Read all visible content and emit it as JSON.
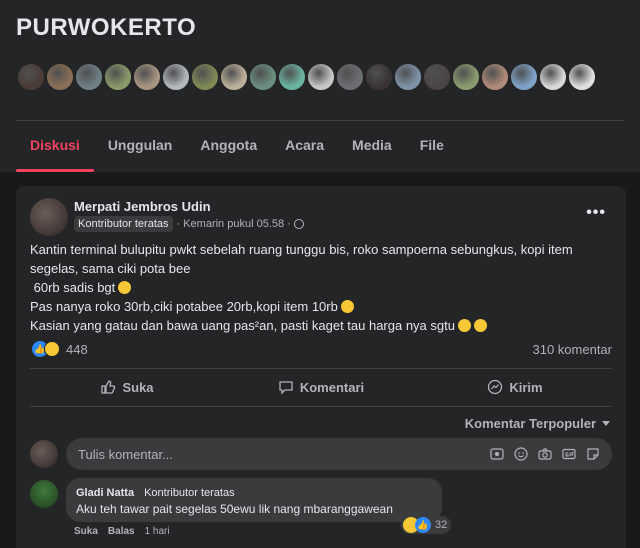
{
  "group": {
    "name": "PURWOKERTO",
    "member_avatars": [
      "#4a3b35",
      "#8a6e55",
      "#6f7f86",
      "#8a9a6a",
      "#a89682",
      "#b2b8bd",
      "#7d8a55",
      "#bdb09a",
      "#6a8f7e",
      "#6bb5a0",
      "#c6c6c6",
      "#6c6f72",
      "#3a3334",
      "#7f93a8",
      "#4b4445",
      "#8a9b6e",
      "#b08a78",
      "#7fa3c8",
      "#d7d8da",
      "#e0e0e0"
    ]
  },
  "tabs": [
    {
      "label": "Diskusi",
      "active": true
    },
    {
      "label": "Unggulan",
      "active": false
    },
    {
      "label": "Anggota",
      "active": false
    },
    {
      "label": "Acara",
      "active": false
    },
    {
      "label": "Media",
      "active": false
    },
    {
      "label": "File",
      "active": false
    }
  ],
  "post": {
    "author": "Merpati Jembros Udin",
    "badge": "Kontributor teratas",
    "time": "· Kemarin pukul 05.58 ·",
    "privacy_icon": "globe-icon",
    "more_label": "•••",
    "lines": [
      "Kantin terminal bulupitu pwkt sebelah ruang tunggu bis, roko sampoerna sebungkus, kopi item",
      "segelas, sama ciki pota bee",
      " 60rb sadis bgt",
      "Pas nanya roko 30rb,ciki potabee 20rb,kopi item 10rb",
      "Kasian yang gatau dan bawa uang pas²an, pasti kaget tau harga nya sgtu"
    ],
    "reaction_count": "448",
    "comment_count": "310 komentar",
    "actions": {
      "like": "Suka",
      "comment": "Komentari",
      "share": "Kirim"
    },
    "sort_label": "Komentar Terpopuler",
    "comment_placeholder": "Tulis komentar..."
  },
  "top_comment": {
    "author": "Gladi Natta",
    "badge": "Kontributor teratas",
    "text": "Aku teh tawar pait segelas 50ewu lik nang mbaranggawean",
    "reaction_count": "32",
    "like_label": "Suka",
    "reply_label": "Balas",
    "time": "1 hari"
  },
  "colors": {
    "accent": "#f3425f",
    "like_blue": "#2d88ff",
    "surface": "#242526",
    "background": "#18191a"
  }
}
